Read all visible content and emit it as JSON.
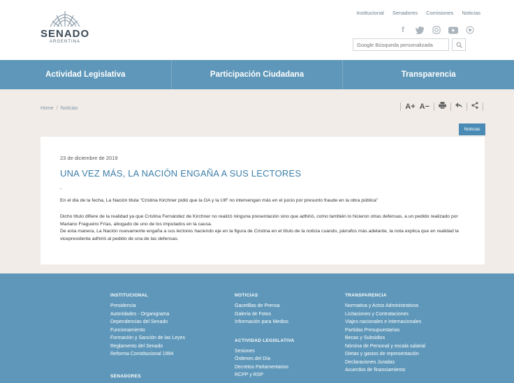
{
  "header": {
    "logo_title": "SENADO",
    "logo_subtitle": "ARGENTINA",
    "top_links": [
      "Institucional",
      "Senadores",
      "Comisiones",
      "Noticias"
    ],
    "social_icons": [
      "facebook-icon",
      "twitter-icon",
      "instagram-icon",
      "youtube-icon",
      "flickr-icon"
    ],
    "search_placeholder": "Google Búsqueda personalizada",
    "search_icon": "magnifier-icon"
  },
  "nav": {
    "items": [
      "Actividad Legislativa",
      "Participación Ciudadana",
      "Transparencia"
    ]
  },
  "breadcrumb": {
    "home": "Home",
    "separator": "/",
    "current": "Noticias"
  },
  "tools": {
    "font_increase": "A+",
    "font_decrease": "A−",
    "print_icon": "printer-icon",
    "back_icon": "back-arrow-icon",
    "share_icon": "share-icon"
  },
  "tag": "Noticias",
  "article": {
    "date": "23 de diciembre de 2019",
    "title": "UNA VEZ MÁS, LA NACIÓN ENGAÑA A SUS LECTORES",
    "bullet": "-",
    "paragraph1": "En el día de la fecha, La Nación titula \"Cristina Kirchner pidió que la OA y la UIF no intervengan más en el juicio por presunto fraude en la obra pública\"",
    "paragraph2": "Dicho título difiere de la realidad ya que Cristina Fernández de Kirchner no realizó ninguna presentación sino que adhirió, como también lo hicieron otras defensas, a un pedido realizado por Mariano Fragueiro Frías, abogado de uno de los imputados en la causa.",
    "paragraph3": "De esta manera, La Nación nuevamente engaña a sus lectores haciendo eje en la figura de Cristina en el título de la noticia cuando, párrafos más adelante, la nota explica que en realidad la vicepresidenta adhirió al pedido de una de las defensas."
  },
  "footer": {
    "col1": {
      "heading": "INSTITUCIONAL",
      "links": [
        "Presidencia",
        "Autoridades - Organigrama",
        "Dependencias del Senado",
        "Funcionamiento",
        "Formación y Sanción de las Leyes",
        "Reglamento del Senado",
        "Reforma Constitucional 1994"
      ],
      "heading2": "SENADORES"
    },
    "col2": {
      "heading": "NOTICIAS",
      "links": [
        "Gacetillas de Prensa",
        "Galería de Fotos",
        "Información para Medios"
      ],
      "heading2": "ACTIVIDAD LEGISLATIVA",
      "links2": [
        "Sesiones",
        "Órdenes del Día",
        "Decretos Parlamentarios",
        "RCPP y RSP"
      ]
    },
    "col3": {
      "heading": "TRANSPARENCIA",
      "links": [
        "Normativa y Actos Administrativos",
        "Licitaciones y Contrataciones",
        "Viajes nacionales e internacionales",
        "Partidas Presupuestarias",
        "Becas y Subsidios",
        "Nómina de Personal y escala salarial",
        "Dietas y gastos de representación",
        "Declaraciones Juradas",
        "Acuerdos de financiamiento"
      ]
    }
  }
}
